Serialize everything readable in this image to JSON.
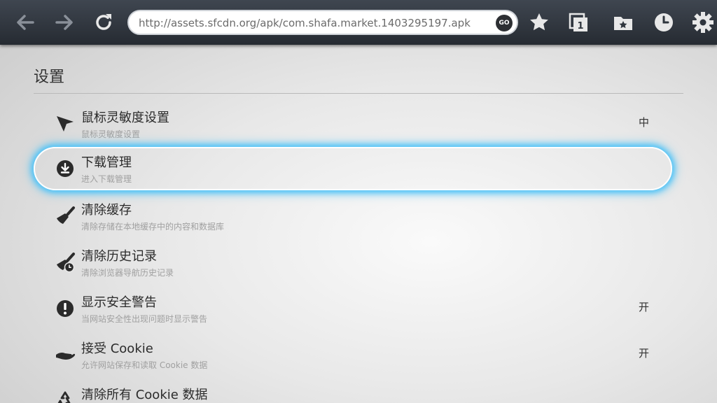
{
  "toolbar": {
    "url": "http://assets.sfcdn.org/apk/com.shafa.market.1403295197.apk",
    "go_label": "GO",
    "tabs_count": "1",
    "icons": [
      "back-arrow-icon",
      "forward-arrow-icon",
      "refresh-icon",
      "star-icon",
      "tabs-icon",
      "bookmarks-folder-icon",
      "history-clock-icon",
      "gear-icon"
    ]
  },
  "page": {
    "title": "设置"
  },
  "settings": [
    {
      "icon": "mouse-pointer-icon",
      "title": "鼠标灵敏度设置",
      "subtitle": "鼠标灵敏度设置",
      "value": "中"
    },
    {
      "icon": "download-icon",
      "title": "下载管理",
      "subtitle": "进入下载管理",
      "value": ""
    },
    {
      "icon": "broom-icon",
      "title": "清除缓存",
      "subtitle": "清除存储在本地缓存中的内容和数据库",
      "value": ""
    },
    {
      "icon": "broom-clock-icon",
      "title": "清除历史记录",
      "subtitle": "清除浏览器导航历史记录",
      "value": ""
    },
    {
      "icon": "warning-icon",
      "title": "显示安全警告",
      "subtitle": "当网站安全性出现问题时显示警告",
      "value": "开"
    },
    {
      "icon": "hand-icon",
      "title": "接受 Cookie",
      "subtitle": "允许网站保存和读取 Cookie 数据",
      "value": "开"
    },
    {
      "icon": "recycle-icon",
      "title": "清除所有 Cookie 数据",
      "subtitle": "",
      "value": ""
    }
  ],
  "colors": {
    "toolbar": "#2f353d",
    "focus_glow": "#4fc3f7"
  }
}
